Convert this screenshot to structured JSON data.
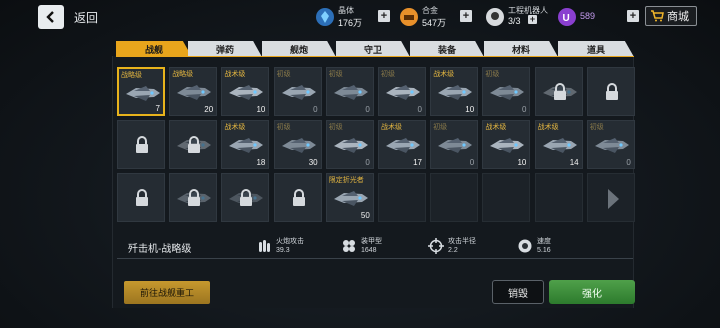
{
  "header": {
    "back_label": "返回",
    "resources": [
      {
        "name": "晶体",
        "value": "176万",
        "icon": "crystal-icon",
        "color": "#3b8fe0"
      },
      {
        "name": "合金",
        "value": "547万",
        "icon": "alloy-icon",
        "color": "#e8902a"
      },
      {
        "name": "工程机器人",
        "value": "3/3",
        "icon": "robot-icon",
        "color": "#d7dadd"
      }
    ],
    "premium": {
      "value": "589",
      "icon": "premium-currency-icon",
      "color": "#8a3fd0"
    },
    "shop_label": "商城"
  },
  "tabs": [
    {
      "label": "战舰",
      "active": true
    },
    {
      "label": "弹药",
      "active": false
    },
    {
      "label": "舰炮",
      "active": false
    },
    {
      "label": "守卫",
      "active": false
    },
    {
      "label": "装备",
      "active": false
    },
    {
      "label": "材料",
      "active": false
    },
    {
      "label": "道具",
      "active": false
    }
  ],
  "grid": [
    [
      {
        "tier": "战略级",
        "count": "7",
        "selected": true,
        "kind": "ship"
      },
      {
        "tier": "战略级",
        "count": "20",
        "kind": "ship"
      },
      {
        "tier": "战术级",
        "count": "10",
        "kind": "ship"
      },
      {
        "tier": "初级",
        "count": "0",
        "kind": "ship"
      },
      {
        "tier": "初级",
        "count": "0",
        "kind": "ship"
      },
      {
        "tier": "初级",
        "count": "0",
        "kind": "ship"
      },
      {
        "tier": "战术级",
        "count": "10",
        "kind": "ship"
      },
      {
        "tier": "初级",
        "count": "0",
        "kind": "ship"
      },
      {
        "tier": "",
        "count": "",
        "kind": "locked-ship"
      },
      {
        "tier": "",
        "count": "",
        "kind": "locked"
      }
    ],
    [
      {
        "tier": "",
        "count": "",
        "kind": "locked"
      },
      {
        "tier": "",
        "count": "",
        "kind": "locked-ship"
      },
      {
        "tier": "战术级",
        "count": "18",
        "kind": "ship"
      },
      {
        "tier": "初级",
        "count": "30",
        "kind": "ship"
      },
      {
        "tier": "初级",
        "count": "0",
        "kind": "ship"
      },
      {
        "tier": "战术级",
        "count": "17",
        "kind": "ship"
      },
      {
        "tier": "初级",
        "count": "0",
        "kind": "ship"
      },
      {
        "tier": "战术级",
        "count": "10",
        "kind": "ship"
      },
      {
        "tier": "战术级",
        "count": "14",
        "kind": "ship"
      },
      {
        "tier": "初级",
        "count": "0",
        "kind": "ship"
      }
    ],
    [
      {
        "tier": "",
        "count": "",
        "kind": "locked"
      },
      {
        "tier": "",
        "count": "",
        "kind": "locked-ship"
      },
      {
        "tier": "",
        "count": "",
        "kind": "locked-ship"
      },
      {
        "tier": "",
        "count": "",
        "kind": "locked"
      },
      {
        "tier": "限定折光者",
        "count": "50",
        "kind": "ship"
      },
      {
        "tier": "",
        "count": "",
        "kind": "empty"
      },
      {
        "tier": "",
        "count": "",
        "kind": "empty"
      },
      {
        "tier": "",
        "count": "",
        "kind": "empty"
      },
      {
        "tier": "",
        "count": "",
        "kind": "empty"
      },
      {
        "tier": "",
        "count": "",
        "kind": "next-page"
      }
    ]
  ],
  "details": {
    "ship_name": "歼击机-战略级",
    "stats": [
      {
        "name": "火炮攻击",
        "value": "39.3",
        "icon": "bullets-icon"
      },
      {
        "name": "装甲型",
        "value": "1648",
        "icon": "armor-icon"
      },
      {
        "name": "攻击半径",
        "value": "2.2",
        "icon": "crosshair-icon"
      },
      {
        "name": "速度",
        "value": "5.16",
        "icon": "speed-icon"
      }
    ]
  },
  "actions": {
    "goto_label": "前往战舰重工",
    "destroy_label": "销毁",
    "upgrade_label": "强化"
  }
}
